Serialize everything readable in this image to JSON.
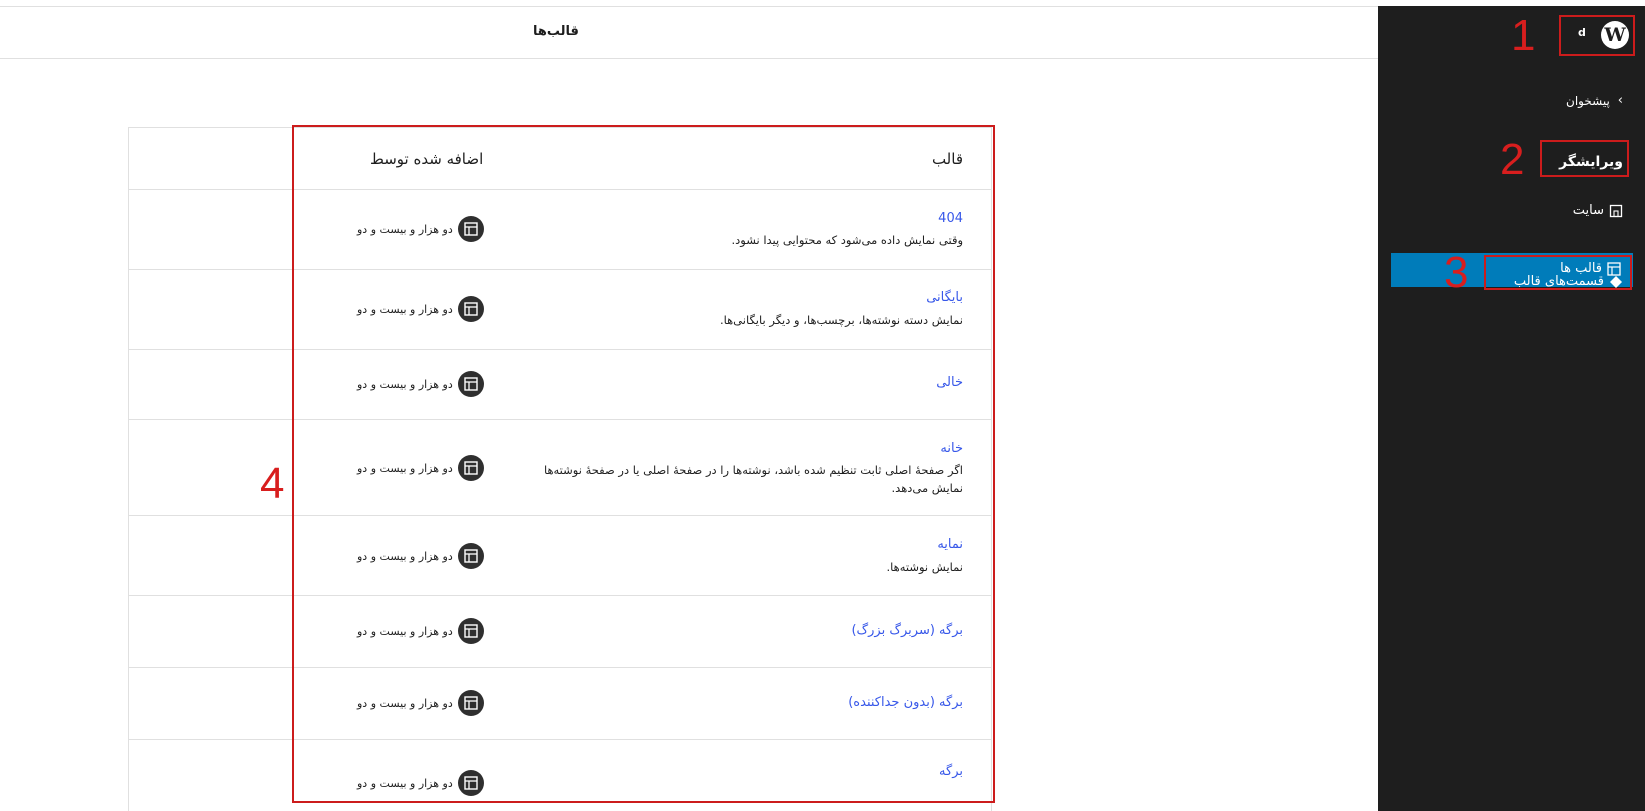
{
  "sidebar": {
    "site_initial": "d",
    "logo_glyph": "W",
    "back_label": "پیشخوان",
    "section_title": "ویرایشگر",
    "items": [
      {
        "label": "سایت",
        "icon": "home-icon",
        "active": false
      },
      {
        "label": "قالب ها",
        "icon": "layout-icon",
        "active": true
      },
      {
        "label": "قسمت‌های قالب",
        "icon": "diamond-icon",
        "active": false
      }
    ],
    "active_color": "#007cba",
    "background": "#1e1e1e"
  },
  "header": {
    "title": "قالب‌ها"
  },
  "table": {
    "columns": {
      "template": "قالب",
      "added_by": "اضافه شده توسط"
    },
    "rows": [
      {
        "title": "404",
        "description": "وقتی نمایش داده می‌شود که محتوایی پیدا نشود.",
        "author": "دو هزار و بیست و دو"
      },
      {
        "title": "بایگانی",
        "description": "نمایش دسته نوشته‌ها، برچسب‌ها، و دیگر بایگانی‌ها.",
        "author": "دو هزار و بیست و دو"
      },
      {
        "title": "خالی",
        "description": "",
        "author": "دو هزار و بیست و دو"
      },
      {
        "title": "خانه",
        "description": "اگر صفحهٔ اصلی ثابت تنظیم شده باشد، نوشته‌ها را در صفحهٔ اصلی یا در صفحهٔ نوشته‌ها نمایش می‌دهد.",
        "author": "دو هزار و بیست و دو"
      },
      {
        "title": "نمایه",
        "description": "نمایش نوشته‌ها.",
        "author": "دو هزار و بیست و دو"
      },
      {
        "title": "برگه (سربرگ بزرگ)",
        "description": "",
        "author": "دو هزار و بیست و دو"
      },
      {
        "title": "برگه (بدون جداکننده)",
        "description": "",
        "author": "دو هزار و بیست و دو"
      },
      {
        "title": "برگه",
        "description": "",
        "author": "دو هزار و بیست و دو"
      }
    ],
    "link_color": "#3858e9"
  },
  "annotations": {
    "labels": [
      "1",
      "2",
      "3",
      "4"
    ],
    "color": "#cc1c1c"
  }
}
